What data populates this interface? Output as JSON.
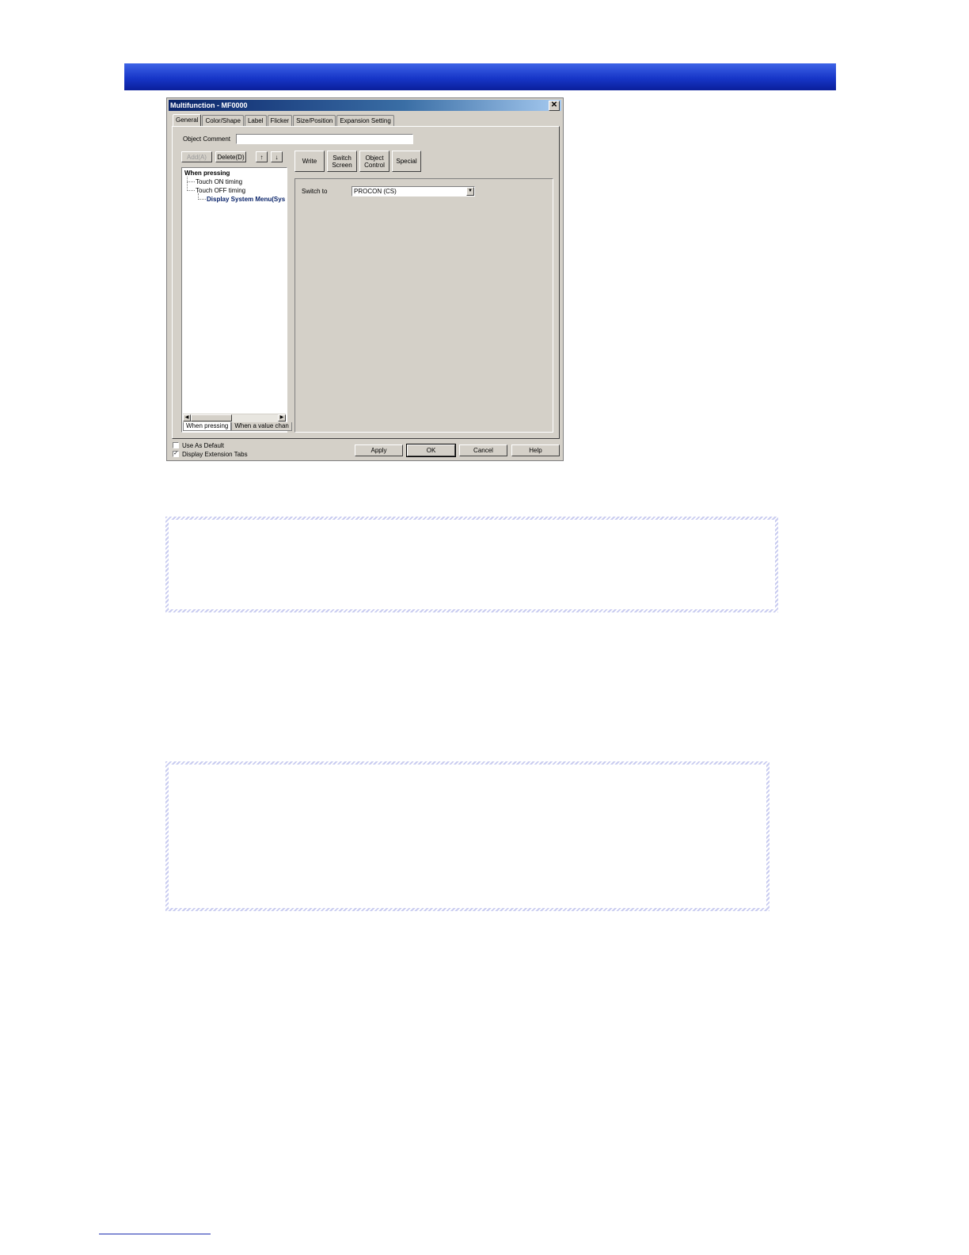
{
  "dialog": {
    "title": "Multifunction - MF0000",
    "close_symbol": "✕",
    "tabs": [
      "General",
      "Color/Shape",
      "Label",
      "Flicker",
      "Size/Position",
      "Expansion Setting"
    ],
    "object_comment_label": "Object Comment",
    "object_comment_value": "",
    "buttons": {
      "add": "Add(A)",
      "delete": "Delete(D)",
      "up": "↑",
      "down": "↓",
      "write": "Write",
      "switch_screen": "Switch Screen",
      "object_control": "Object Control",
      "special": "Special",
      "apply": "Apply",
      "ok": "OK",
      "cancel": "Cancel",
      "help": "Help"
    },
    "tree": {
      "root": "When pressing",
      "items": [
        "Touch ON timing",
        "Touch OFF timing"
      ],
      "selected": "Display System Menu(Sys"
    },
    "bottom_tabs": [
      "When pressing",
      "When a value chan"
    ],
    "switch_to_label": "Switch to",
    "switch_to_value": "PROCON (CS)",
    "checkboxes": [
      {
        "label": "Use As Default",
        "checked": false
      },
      {
        "label": "Display Extension Tabs",
        "checked": true
      }
    ],
    "icons": {
      "combo_arrow": "▼",
      "scroll_left": "◀",
      "scroll_right": "▶",
      "check_mark": "✓"
    }
  },
  "colors": {
    "header_bar": "#1736c8",
    "dialog_face": "#d4d0c8",
    "title_bar": "#0a246a",
    "note_border": "#c9ccf0"
  }
}
